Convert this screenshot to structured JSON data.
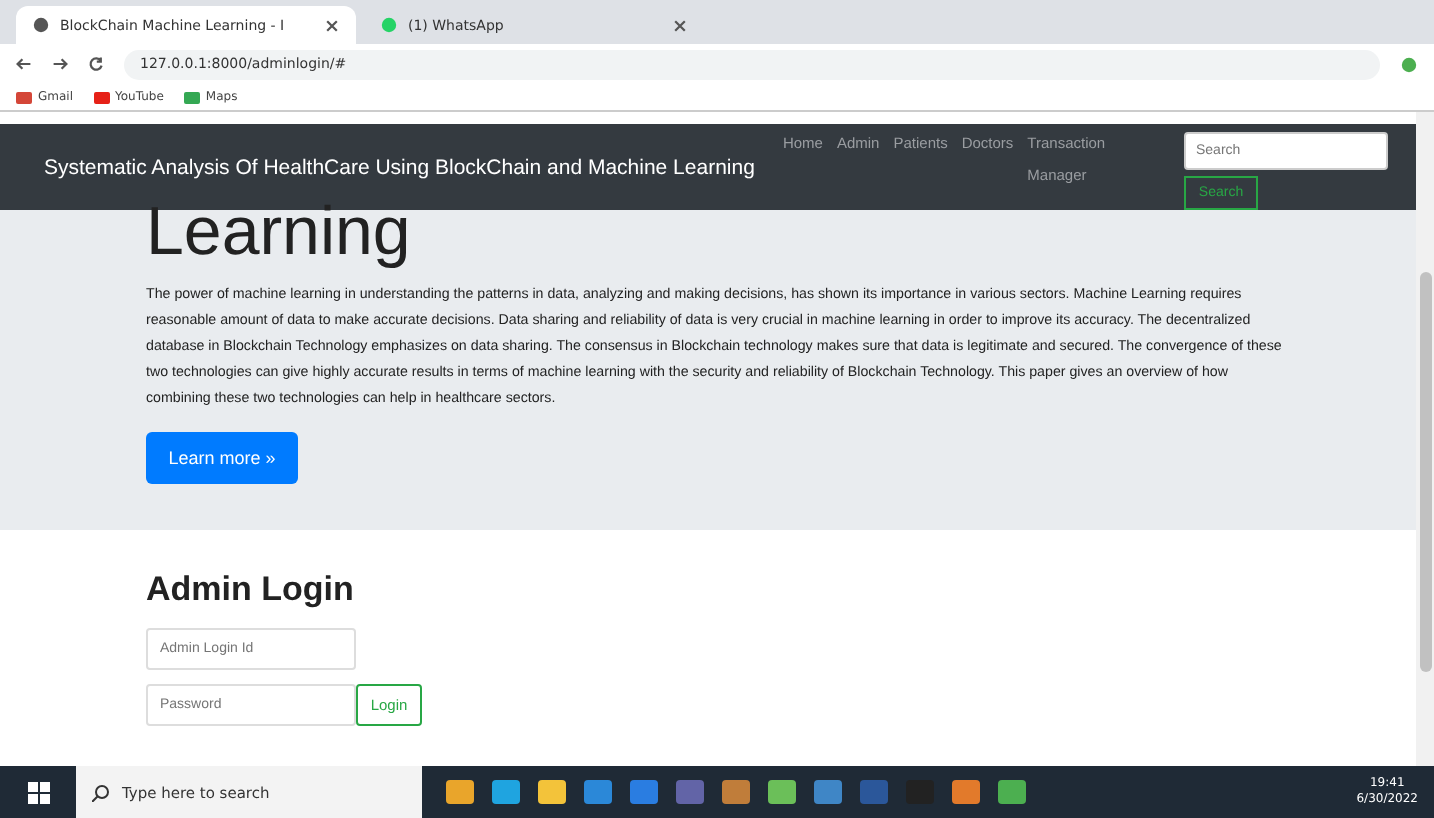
{
  "browser": {
    "tabs": [
      {
        "title": "BlockChain Machine Learning - I",
        "selected": true
      },
      {
        "title": "(1) WhatsApp",
        "selected": false
      }
    ],
    "url": "127.0.0.1:8000/adminlogin/#",
    "bookmarks": [
      "Gmail",
      "YouTube",
      "Maps"
    ]
  },
  "navbar": {
    "brand": "Systematic Analysis Of HealthCare Using BlockChain and Machine Learning",
    "links": [
      "Home",
      "Admin",
      "Patients",
      "Doctors",
      "Transaction Manager"
    ],
    "search": {
      "placeholder": "Search"
    },
    "search_button": "Search"
  },
  "hero": {
    "heading": "Learning",
    "text": "The power of machine learning in understanding the patterns in data, analyzing and making decisions, has shown its importance in various sectors. Machine Learning requires reasonable amount of data to make accurate decisions. Data sharing and reliability of data is very crucial in machine learning in order to improve its accuracy. The decentralized database in Blockchain Technology emphasizes on data sharing. The consensus in Blockchain technology makes sure that data is legitimate and secured. The convergence of these two technologies can give highly accurate results in terms of machine learning with the security and reliability of Blockchain Technology. This paper gives an overview of how combining these two technologies can help in healthcare sectors.",
    "button": "Learn more »"
  },
  "login": {
    "title": "Admin Login",
    "id_field": {
      "placeholder": "Admin Login Id"
    },
    "password_field": {
      "placeholder": "Password"
    },
    "button": "Login"
  },
  "taskbar": {
    "search": "Type here to search",
    "time": "19:41",
    "date": "6/30/2022"
  }
}
